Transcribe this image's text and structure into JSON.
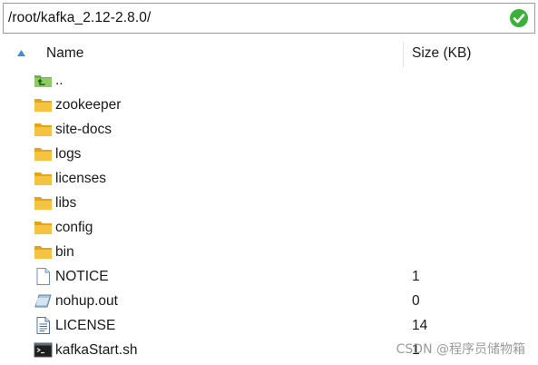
{
  "path_bar": {
    "value": "/root/kafka_2.12-2.8.0/"
  },
  "header": {
    "name_label": "Name",
    "size_label": "Size (KB)",
    "sort_icon": "sort-ascending-icon"
  },
  "files": [
    {
      "name": "..",
      "size": "",
      "icon": "parent-folder-icon"
    },
    {
      "name": "zookeeper",
      "size": "",
      "icon": "folder-icon"
    },
    {
      "name": "site-docs",
      "size": "",
      "icon": "folder-icon"
    },
    {
      "name": "logs",
      "size": "",
      "icon": "folder-icon"
    },
    {
      "name": "licenses",
      "size": "",
      "icon": "folder-icon"
    },
    {
      "name": "libs",
      "size": "",
      "icon": "folder-icon"
    },
    {
      "name": "config",
      "size": "",
      "icon": "folder-icon"
    },
    {
      "name": "bin",
      "size": "",
      "icon": "folder-icon"
    },
    {
      "name": "NOTICE",
      "size": "1",
      "icon": "blank-file-icon"
    },
    {
      "name": "nohup.out",
      "size": "0",
      "icon": "generic-file-icon"
    },
    {
      "name": "LICENSE",
      "size": "14",
      "icon": "text-file-icon"
    },
    {
      "name": "kafkaStart.sh",
      "size": "1",
      "icon": "shell-script-icon"
    }
  ],
  "watermark": "CSDN @程序员储物箱",
  "colors": {
    "folder": "#f5c342",
    "folder_dark": "#e0a51c",
    "go_button": "#3bb03b",
    "sort_arrow": "#3c8fd9"
  }
}
